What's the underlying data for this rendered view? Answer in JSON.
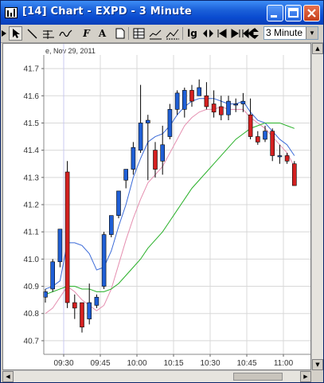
{
  "window": {
    "title": "[14] Chart - EXPD - 3 Minute",
    "icon": "chart-app-icon",
    "controls": [
      "minimize-icon",
      "maximize-icon",
      "close-icon"
    ]
  },
  "toolbar": {
    "tools": [
      "cursor-icon",
      "pointer-icon",
      "trendline-icon",
      "fibonacci-icon",
      "freehand-icon",
      "font-icon",
      "text-icon",
      "page-icon",
      "data-window-icon",
      "indicator-icon",
      "lg-log-icon",
      "zoom-icon",
      "scroll-start-icon",
      "scroll-end-icon",
      "scroll-left-icon",
      "up-down-icon"
    ],
    "font_label": "F",
    "text_label": "A",
    "log_label": "lg",
    "interval_value": "3 Minute"
  },
  "colors": {
    "up_candle": "#1f5fd6",
    "down_candle": "#d42020",
    "ma_fast": "#3a6ad8",
    "ma_mid": "#e58fb0",
    "ma_slow": "#28b028",
    "grid": "#d8d8d8"
  },
  "chart_data": {
    "type": "candlestick",
    "date_label": "e, Nov 29, 2011",
    "y_ticks": [
      "41.7",
      "41.6",
      "41.5",
      "41.4",
      "41.3",
      "41.2",
      "41.1",
      "41.0",
      "40.9",
      "40.8",
      "40.7"
    ],
    "ylim": [
      40.65,
      41.75
    ],
    "x_ticks": [
      "09:30",
      "09:45",
      "10:00",
      "10:15",
      "10:30",
      "10:45",
      "11:00"
    ],
    "grid": true,
    "candles": [
      {
        "o": 40.86,
        "h": 40.89,
        "l": 40.84,
        "c": 40.88
      },
      {
        "o": 40.89,
        "h": 41.0,
        "l": 40.88,
        "c": 40.99
      },
      {
        "o": 40.99,
        "h": 41.11,
        "l": 40.97,
        "c": 41.11
      },
      {
        "o": 41.32,
        "h": 41.36,
        "l": 40.82,
        "c": 40.84
      },
      {
        "o": 40.84,
        "h": 40.87,
        "l": 40.78,
        "c": 40.82
      },
      {
        "o": 40.84,
        "h": 40.84,
        "l": 40.73,
        "c": 40.75
      },
      {
        "o": 40.78,
        "h": 40.91,
        "l": 40.76,
        "c": 40.84
      },
      {
        "o": 40.83,
        "h": 40.87,
        "l": 40.82,
        "c": 40.86
      },
      {
        "o": 40.9,
        "h": 41.1,
        "l": 40.89,
        "c": 41.09
      },
      {
        "o": 41.09,
        "h": 41.16,
        "l": 41.08,
        "c": 41.16
      },
      {
        "o": 41.16,
        "h": 41.25,
        "l": 41.15,
        "c": 41.25
      },
      {
        "o": 41.29,
        "h": 41.32,
        "l": 41.26,
        "c": 41.33
      },
      {
        "o": 41.33,
        "h": 41.43,
        "l": 41.31,
        "c": 41.41
      },
      {
        "o": 41.4,
        "h": 41.64,
        "l": 41.39,
        "c": 41.5
      },
      {
        "o": 41.5,
        "h": 41.53,
        "l": 41.29,
        "c": 41.51
      },
      {
        "o": 41.4,
        "h": 41.43,
        "l": 41.3,
        "c": 41.33
      },
      {
        "o": 41.36,
        "h": 41.49,
        "l": 41.31,
        "c": 41.42
      },
      {
        "o": 41.45,
        "h": 41.57,
        "l": 41.44,
        "c": 41.55
      },
      {
        "o": 41.55,
        "h": 41.62,
        "l": 41.53,
        "c": 41.61
      },
      {
        "o": 41.55,
        "h": 41.63,
        "l": 41.52,
        "c": 41.62
      },
      {
        "o": 41.62,
        "h": 41.64,
        "l": 41.56,
        "c": 41.58
      },
      {
        "o": 41.6,
        "h": 41.66,
        "l": 41.6,
        "c": 41.63
      },
      {
        "o": 41.6,
        "h": 41.65,
        "l": 41.55,
        "c": 41.56
      },
      {
        "o": 41.57,
        "h": 41.62,
        "l": 41.52,
        "c": 41.54
      },
      {
        "o": 41.56,
        "h": 41.6,
        "l": 41.51,
        "c": 41.53
      },
      {
        "o": 41.53,
        "h": 41.6,
        "l": 41.51,
        "c": 41.58
      },
      {
        "o": 41.57,
        "h": 41.59,
        "l": 41.54,
        "c": 41.57
      },
      {
        "o": 41.57,
        "h": 41.61,
        "l": 41.54,
        "c": 41.58
      },
      {
        "o": 41.53,
        "h": 41.59,
        "l": 41.44,
        "c": 41.45
      },
      {
        "o": 41.45,
        "h": 41.47,
        "l": 41.42,
        "c": 41.43
      },
      {
        "o": 41.44,
        "h": 41.49,
        "l": 41.43,
        "c": 41.47
      },
      {
        "o": 41.47,
        "h": 41.48,
        "l": 41.36,
        "c": 41.38
      },
      {
        "o": 41.38,
        "h": 41.42,
        "l": 41.35,
        "c": 41.38
      },
      {
        "o": 41.38,
        "h": 41.39,
        "l": 41.35,
        "c": 41.36
      },
      {
        "o": 41.35,
        "h": 41.36,
        "l": 41.27,
        "c": 41.27
      }
    ],
    "series": [
      {
        "values": [
          40.89,
          40.9,
          40.92,
          41.06,
          41.06,
          41.05,
          41.02,
          40.96,
          40.97,
          41.03,
          41.12,
          41.2,
          41.3,
          41.37,
          41.43,
          41.45,
          41.46,
          41.49,
          41.53,
          41.56,
          41.58,
          41.59,
          41.59,
          41.59,
          41.58,
          41.57,
          41.57,
          41.58,
          41.54,
          41.51,
          41.5,
          41.47,
          41.44,
          41.42,
          41.38
        ]
      },
      {
        "values": [
          40.8,
          40.82,
          40.86,
          40.9,
          40.88,
          40.85,
          40.83,
          40.81,
          40.83,
          40.89,
          40.98,
          41.07,
          41.15,
          41.22,
          41.28,
          41.31,
          41.34,
          41.39,
          41.44,
          41.49,
          41.52,
          41.54,
          41.55,
          41.55,
          41.56,
          41.55,
          41.55,
          41.55,
          41.52,
          41.5,
          41.48,
          41.45,
          41.42,
          41.39,
          41.34
        ]
      },
      {
        "values": [
          40.87,
          40.88,
          40.89,
          40.9,
          40.9,
          40.89,
          40.89,
          40.88,
          40.88,
          40.89,
          40.91,
          40.94,
          40.97,
          41.0,
          41.04,
          41.07,
          41.1,
          41.14,
          41.18,
          41.22,
          41.26,
          41.29,
          41.32,
          41.35,
          41.38,
          41.41,
          41.44,
          41.46,
          41.48,
          41.49,
          41.5,
          41.5,
          41.5,
          41.49,
          41.48
        ]
      }
    ]
  }
}
